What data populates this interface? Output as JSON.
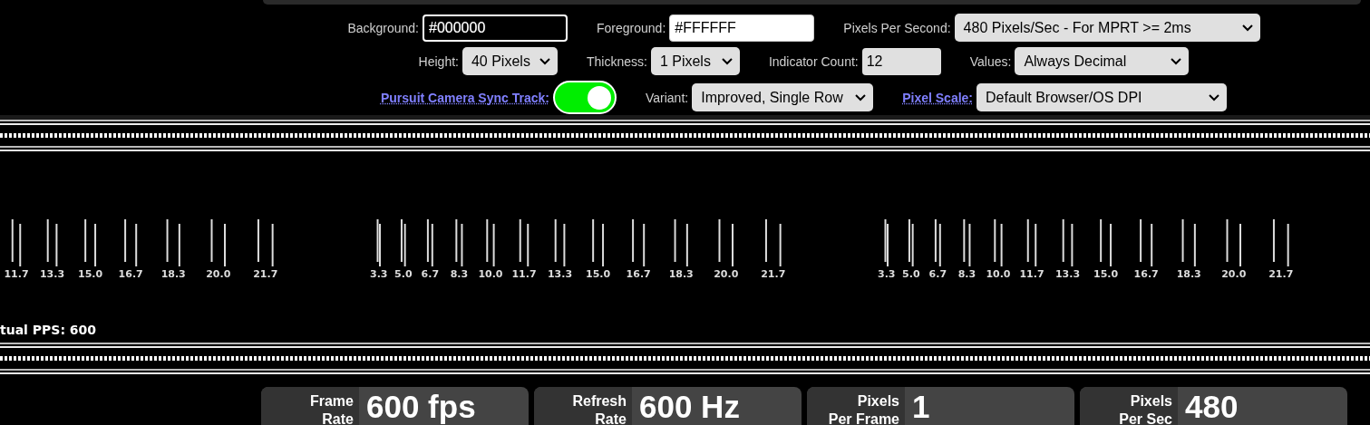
{
  "controls": {
    "background": {
      "label": "Background:",
      "value": "#000000"
    },
    "foreground": {
      "label": "Foreground:",
      "value": "#FFFFFF"
    },
    "pixels_per_second": {
      "label": "Pixels Per Second:",
      "value": "480 Pixels/Sec - For MPRT >= 2ms"
    },
    "height": {
      "label": "Height:",
      "value": "40 Pixels"
    },
    "thickness": {
      "label": "Thickness:",
      "value": "1 Pixels"
    },
    "indicator_count": {
      "label": "Indicator Count:",
      "value": "12"
    },
    "values": {
      "label": "Values:",
      "value": "Always Decimal"
    },
    "sync_track": {
      "label": "Pursuit Camera Sync Track:",
      "on": true
    },
    "variant": {
      "label": "Variant:",
      "value": "Improved, Single Row"
    },
    "pixel_scale": {
      "label": "Pixel Scale:",
      "value": "Default Browser/OS DPI"
    }
  },
  "track": {
    "groups": [
      {
        "labels": [
          "11.7",
          "13.3",
          "15.0",
          "16.7",
          "18.3",
          "20.0",
          "21.7"
        ]
      },
      {
        "labels": [
          "3.3",
          "5.0",
          "6.7",
          "8.3",
          "10.0",
          "11.7",
          "13.3",
          "15.0",
          "16.7",
          "18.3",
          "20.0",
          "21.7"
        ]
      },
      {
        "labels": [
          "3.3",
          "5.0",
          "6.7",
          "8.3",
          "10.0",
          "11.7",
          "13.3",
          "15.0",
          "16.7",
          "18.3",
          "20.0",
          "21.7"
        ]
      }
    ],
    "status": "tual PPS: 600"
  },
  "stats": [
    {
      "label": [
        "Frame",
        "Rate"
      ],
      "value": "600 fps"
    },
    {
      "label": [
        "Refresh",
        "Rate"
      ],
      "value": "600 Hz"
    },
    {
      "label": [
        "Pixels",
        "Per Frame"
      ],
      "value": "1"
    },
    {
      "label": [
        "Pixels",
        "Per Sec"
      ],
      "value": "480"
    }
  ]
}
